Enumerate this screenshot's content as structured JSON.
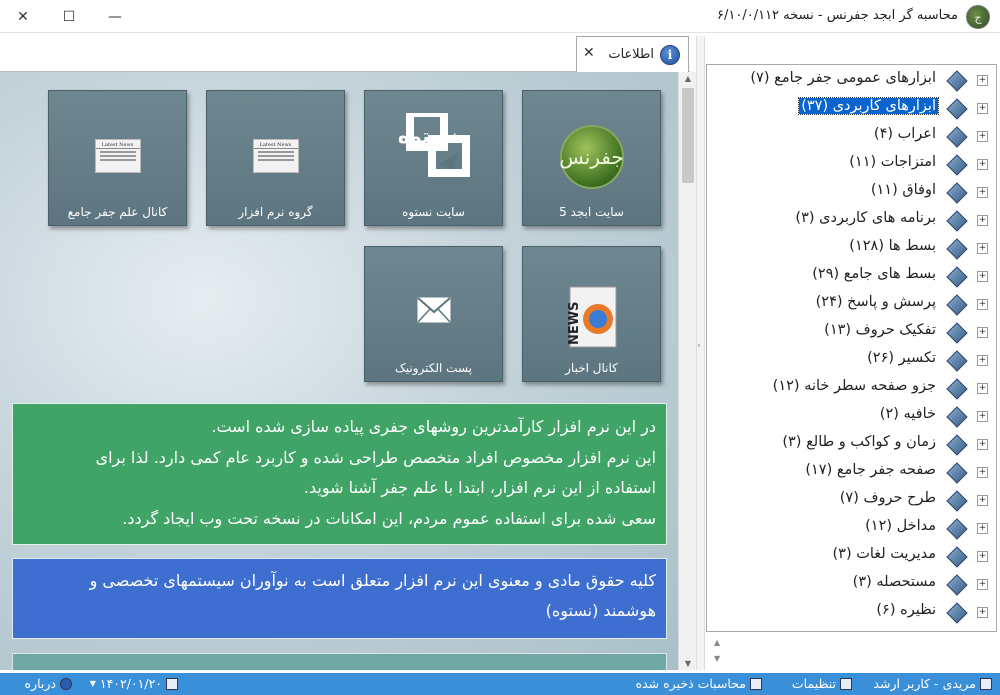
{
  "window": {
    "title": "محاسبه گر ابجد جفرنس - نسخه ۶/۱۰/۰/۱۱۲"
  },
  "tab": {
    "label": "اطلاعات"
  },
  "tiles": [
    {
      "label": "سایت ابجد 5",
      "icon": "abjad-logo",
      "logo_text": "جفرنس"
    },
    {
      "label": "سایت نستوه",
      "icon": "nastooh-logo",
      "logo_text": "نستوه"
    },
    {
      "label": "گروه نرم افزار",
      "icon": "newspaper-icon",
      "news_head": "Latest News"
    },
    {
      "label": "کانال علم جفر جامع",
      "icon": "newspaper-icon",
      "news_head": "Latest News"
    },
    {
      "label": "کانال اخبار",
      "icon": "news-icon",
      "news_text": "NEWS"
    },
    {
      "label": "پست الکترونیک",
      "icon": "mail-icon"
    }
  ],
  "info_green": [
    "در این نرم افزار کارآمدترین روشهای جفری پیاده سازی شده است.",
    "این نرم افزار مخصوص افراد متخصص طراحی شده و کاربرد عام کمی دارد. لذا برای",
    "استفاده از این نرم افزار، ابتدا با علم جفر آشنا شوید.",
    "سعی شده برای استفاده عموم مردم، این امکانات در نسخه تحت وب ایجاد گردد."
  ],
  "info_blue": [
    "کلیه حقوق مادی و معنوی این نرم افزار متعلق است به نوآوران سیستمهای تخصصی و",
    "هوشمند (نستوه)"
  ],
  "tree": {
    "selected_index": 1,
    "items": [
      "ابزارهای عمومی جفر جامع (۷)",
      "ابزارهای کاربردی (۳۷)",
      "اعراب (۴)",
      "امتزاجات (۱۱)",
      "اوفاق (۱۱)",
      "برنامه های کاربردی (۳)",
      "بسط ها (۱۲۸)",
      "بسط های جامع (۲۹)",
      "پرسش و پاسخ (۲۴)",
      "تفکیک حروف (۱۳)",
      "تکسیر (۲۶)",
      "جزو صفحه سطر خانه (۱۲)",
      "خافیه (۲)",
      "زمان و کواکب و طالع (۳)",
      "صفحه جفر جامع (۱۷)",
      "طرح حروف (۷)",
      "مداخل (۱۲)",
      "مدیریت لغات (۳)",
      "مستحصله (۳)",
      "نظیره (۶)"
    ]
  },
  "statusbar": {
    "user": "مریدی - کاربر ارشد",
    "settings": "تنظیمات",
    "calc_saved": "محاسبات ذخیره شده",
    "date": "۱۴۰۲/۰۱/۲۰",
    "about": "درباره"
  },
  "colors": {
    "green_box": "#3fa466",
    "blue_box": "#3e6fd0",
    "statusbar": "#3a8fd9",
    "tile": "#5c7580",
    "selection": "#0a64d0"
  }
}
